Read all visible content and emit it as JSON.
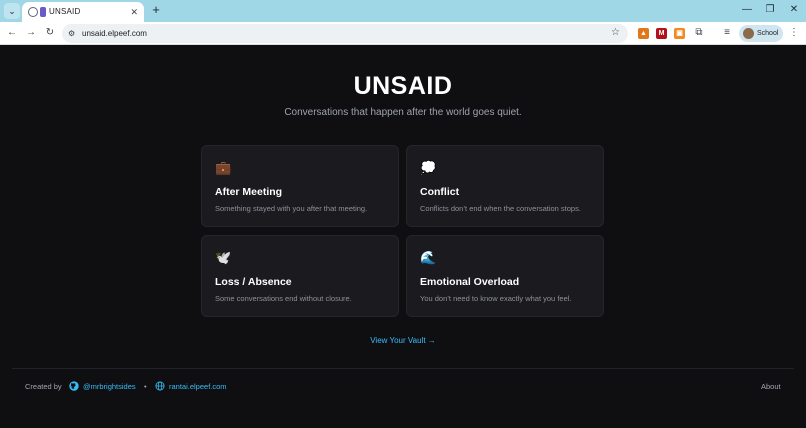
{
  "browser": {
    "tab_title": "UNSAID",
    "tab_close": "✕",
    "new_tab": "+",
    "url": "unsaid.elpeef.com",
    "profile_label": "School",
    "window_controls": {
      "minimize": "—",
      "restore": "❐",
      "close": "✕"
    },
    "nav": {
      "back": "←",
      "forward": "→",
      "reload": "↻"
    },
    "star": "☆",
    "menu": "⋮"
  },
  "page": {
    "title": "UNSAID",
    "tagline": "Conversations that happen after the world goes quiet.",
    "cards": [
      {
        "emoji": "💼",
        "title": "After Meeting",
        "description": "Something stayed with you after that meeting."
      },
      {
        "emoji": "💭",
        "title": "Conflict",
        "description": "Conflicts don’t end when the conversation stops."
      },
      {
        "emoji": "🕊️",
        "title": "Loss / Absence",
        "description": "Some conversations end without closure."
      },
      {
        "emoji": "🌊",
        "title": "Emotional Overload",
        "description": "You don’t need to know exactly what you feel."
      }
    ],
    "vault_link": "View Your Vault →"
  },
  "footer": {
    "created_by": "Created by",
    "github_handle": "@mrbrightsides",
    "separator": "•",
    "site_link": "rantai.elpeef.com",
    "about": "About"
  },
  "colors": {
    "background": "#0f0f12",
    "card": "#1a1a1f",
    "accent": "#38bdf8",
    "chrome_tabstrip": "#9fd7e6"
  },
  "icons": {
    "github": "github-icon",
    "globe": "globe-icon"
  }
}
